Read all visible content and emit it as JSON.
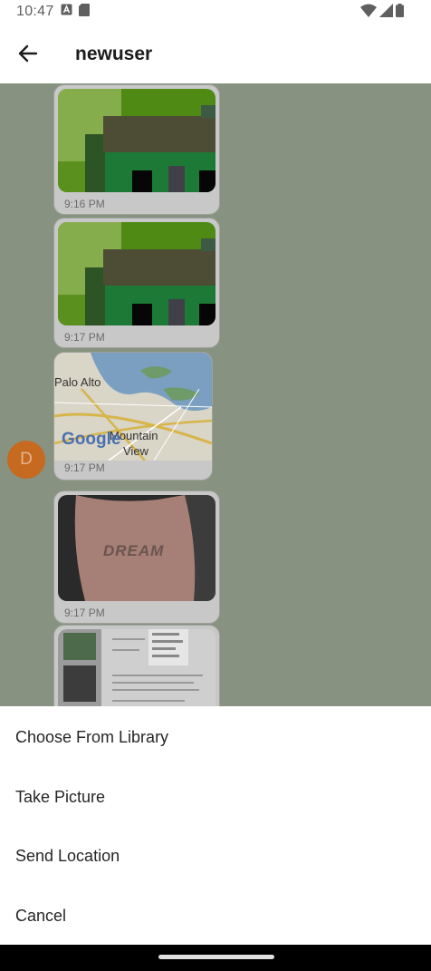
{
  "status_bar": {
    "time": "10:47",
    "icons": [
      "a-notification-icon",
      "sd-card-icon",
      "wifi-icon",
      "signal-icon",
      "battery-icon"
    ]
  },
  "app_bar": {
    "title": "newuser",
    "back_icon": "arrow-left-icon"
  },
  "chat": {
    "avatar_initial": "D",
    "messages": [
      {
        "type": "image",
        "time": "9:16 PM"
      },
      {
        "type": "image",
        "time": "9:17 PM"
      },
      {
        "type": "map",
        "time": "9:17 PM",
        "map_labels": [
          "Palo Alto",
          "Mountain",
          "View"
        ],
        "map_logo": "Google"
      },
      {
        "type": "image",
        "time": "9:17 PM",
        "image_text": "DREAM"
      },
      {
        "type": "image"
      }
    ]
  },
  "sheet": {
    "options": [
      "Choose From Library",
      "Take Picture",
      "Send Location",
      "Cancel"
    ]
  },
  "colors": {
    "overlay": "#879281",
    "bubble": "#c8c8c8",
    "avatar": "#c66a1f"
  }
}
